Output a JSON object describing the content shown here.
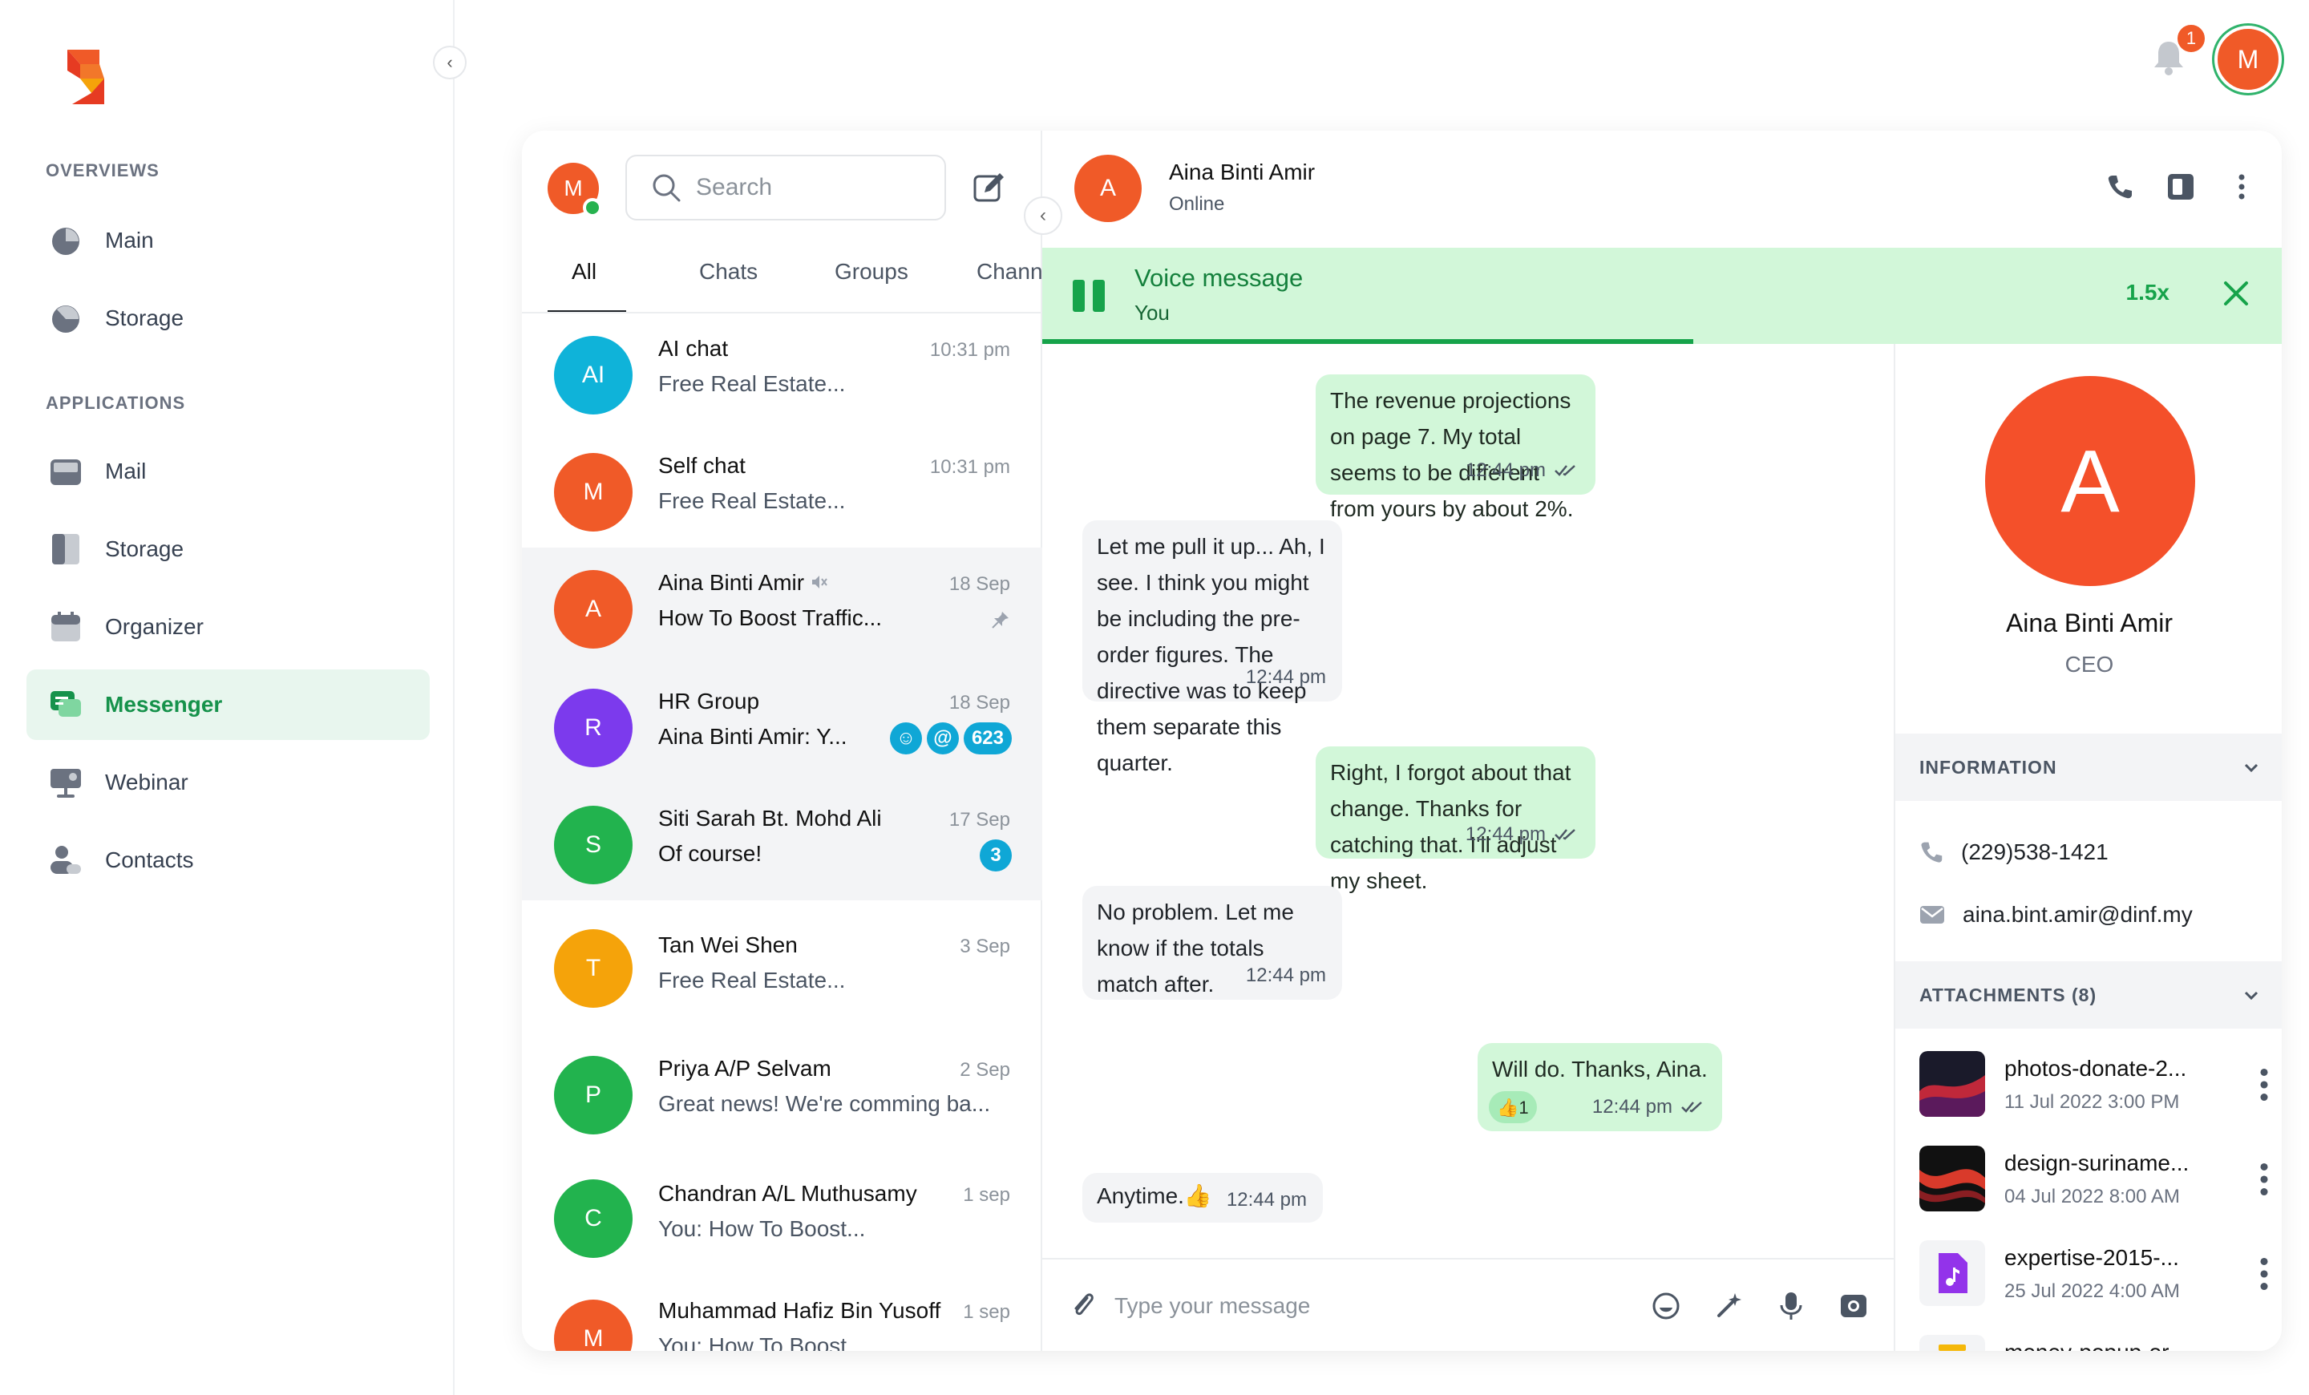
{
  "app": {
    "sidebar": {
      "sections": [
        {
          "title": "OVERVIEWS",
          "items": [
            {
              "label": "Main",
              "icon": "dashboard-icon"
            },
            {
              "label": "Storage",
              "icon": "gauge-icon"
            }
          ]
        },
        {
          "title": "APPLICATIONS",
          "items": [
            {
              "label": "Mail",
              "icon": "inbox-icon"
            },
            {
              "label": "Storage",
              "icon": "file-storage-icon"
            },
            {
              "label": "Organizer",
              "icon": "calendar-icon"
            },
            {
              "label": "Messenger",
              "icon": "chat-icon",
              "active": true
            },
            {
              "label": "Webinar",
              "icon": "presentation-icon"
            },
            {
              "label": "Contacts",
              "icon": "contacts-icon"
            }
          ]
        }
      ]
    },
    "topbar": {
      "notification_count": "1",
      "user_initial": "M"
    }
  },
  "chat_list": {
    "user_initial": "M",
    "search_placeholder": "Search",
    "tabs": [
      "All",
      "Chats",
      "Groups",
      "Chann"
    ],
    "active_tab": "All",
    "chats": [
      {
        "initial": "AI",
        "name": "AI chat",
        "time": "10:31 pm",
        "preview": "Free Real Estate...",
        "color": "#0fb3d9"
      },
      {
        "initial": "M",
        "name": "Self chat",
        "time": "10:31 pm",
        "preview": "Free Real Estate...",
        "color": "#f05a28"
      },
      {
        "initial": "A",
        "name": "Aina Binti Amir",
        "time": "18 Sep",
        "preview": "How To Boost Traffic...",
        "color": "#f05a28",
        "muted": true,
        "pinned": true,
        "selected": true
      },
      {
        "initial": "R",
        "name": "HR Group",
        "time": "18 Sep",
        "preview": "Aina Binti Amir: Y...",
        "color": "#7c3aed",
        "badges": [
          "☺",
          "@",
          "623"
        ],
        "selected": true
      },
      {
        "initial": "S",
        "name": "Siti Sarah Bt. Mohd Ali",
        "time": "17 Sep",
        "preview": "Of course!",
        "color": "#22b34e",
        "badges": [
          "3"
        ],
        "selected": true
      },
      {
        "initial": "T",
        "name": "Tan Wei Shen",
        "time": "3 Sep",
        "preview": "Free Real Estate...",
        "color": "#f5a30a"
      },
      {
        "initial": "P",
        "name": "Priya A/P Selvam",
        "time": "2 Sep",
        "preview": "Great news! We're comming ba...",
        "color": "#22b34e"
      },
      {
        "initial": "C",
        "name": "Chandran A/L Muthusamy",
        "time": "1 sep",
        "preview": "You: How To Boost...",
        "color": "#22b34e"
      },
      {
        "initial": "M",
        "name": "Muhammad Hafiz Bin Yusoff",
        "time": "1 sep",
        "preview": "You: How To Boost...",
        "color": "#f05a28"
      }
    ]
  },
  "conversation": {
    "contact": {
      "initial": "A",
      "name": "Aina Binti Amir",
      "status": "Online"
    },
    "voice": {
      "title": "Voice message",
      "sender": "You",
      "speed": "1.5x",
      "progress": 0.525
    },
    "messages": [
      {
        "dir": "out",
        "text": "The revenue projections on page 7. My total seems to be different from yours by about 2%.",
        "time": "12:44 pm",
        "read": true
      },
      {
        "dir": "in",
        "text": "Let me pull it up... Ah, I see. I think you might be including the pre-order figures. The directive was to keep them separate this quarter.",
        "time": "12:44 pm"
      },
      {
        "dir": "out",
        "text": "Right, I forgot about that change. Thanks for catching that. I'll adjust my sheet.",
        "time": "12:44 pm",
        "read": true
      },
      {
        "dir": "in",
        "text": "No problem. Let me know if the totals match after.",
        "time": "12:44 pm"
      },
      {
        "dir": "out",
        "text": "Will do. Thanks, Aina.",
        "time": "12:44 pm",
        "read": true,
        "reaction": "👍1"
      },
      {
        "dir": "in",
        "text": "Anytime.👍",
        "time": "12:44 pm"
      }
    ],
    "composer_placeholder": "Type your message"
  },
  "info_panel": {
    "initial": "A",
    "name": "Aina Binti Amir",
    "role": "CEO",
    "information_title": "INFORMATION",
    "phone": "(229)538-1421",
    "email": "aina.bint.amir@dinf.my",
    "attachments_title": "ATTACHMENTS (8)",
    "attachments": [
      {
        "name": "photos-donate-2...",
        "date": "11 Jul 2022 3:00 PM",
        "kind": "image"
      },
      {
        "name": "design-suriname...",
        "date": "04 Jul 2022 8:00 AM",
        "kind": "image"
      },
      {
        "name": "expertise-2015-...",
        "date": "25 Jul 2022 4:00 AM",
        "kind": "audio"
      },
      {
        "name": "money-popup-or...",
        "date": "",
        "kind": "file"
      }
    ]
  }
}
